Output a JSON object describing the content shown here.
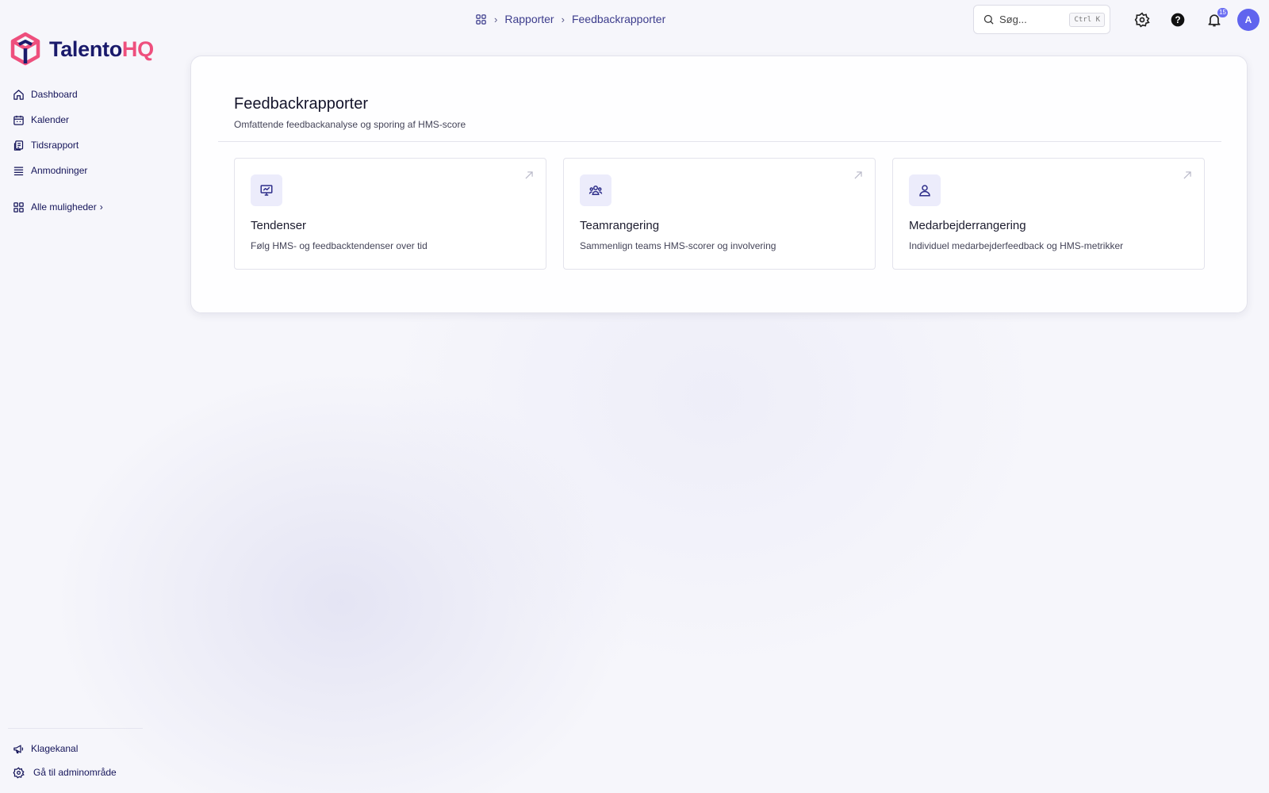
{
  "app": {
    "logo_primary": "Talento",
    "logo_accent": "HQ",
    "brand_colors": {
      "navy": "#1a1a6b",
      "pink": "#ee4f7d",
      "accent": "#6064ee"
    }
  },
  "sidebar": {
    "items": [
      {
        "label": "Dashboard",
        "icon": "home-icon"
      },
      {
        "label": "Kalender",
        "icon": "calendar-icon"
      },
      {
        "label": "Tidsrapport",
        "icon": "timesheet-icon"
      },
      {
        "label": "Anmodninger",
        "icon": "list-icon"
      }
    ],
    "more_label": "Alle muligheder",
    "bottom": [
      {
        "label": "Klagekanal",
        "icon": "megaphone-icon"
      },
      {
        "label": "Gå til adminområde",
        "icon": "gear-icon"
      }
    ]
  },
  "header": {
    "breadcrumb": [
      "Rapporter",
      "Feedbackrapporter"
    ],
    "search_placeholder": "Søg...",
    "search_shortcut": "Ctrl K",
    "notification_count": "15",
    "avatar_initial": "A"
  },
  "main": {
    "title": "Feedbackrapporter",
    "subtitle": "Omfattende feedbackanalyse og sporing af HMS-score",
    "cards": [
      {
        "title": "Tendenser",
        "description": "Følg HMS- og feedbacktendenser over tid",
        "icon": "presentation-chart-icon"
      },
      {
        "title": "Teamrangering",
        "description": "Sammenlign teams HMS-scorer og involvering",
        "icon": "team-icon"
      },
      {
        "title": "Medarbejderrangering",
        "description": "Individuel medarbejderfeedback og HMS-metrikker",
        "icon": "user-icon"
      }
    ]
  }
}
